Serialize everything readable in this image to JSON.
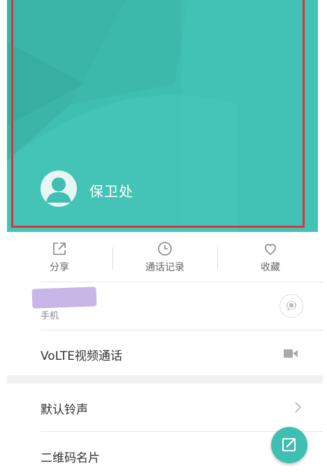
{
  "contact": {
    "name": "保卫处"
  },
  "actions": {
    "share": "分享",
    "call_log": "通话记录",
    "favorite": "收藏"
  },
  "phone": {
    "type_label": "手机"
  },
  "volte": {
    "label": "VoLTE视频通话"
  },
  "ringtone": {
    "label": "默认铃声"
  },
  "qrcard": {
    "label": "二维码名片"
  },
  "colors": {
    "header_teal": "#3fbfb1",
    "highlight_red": "#d9343b",
    "redaction_purple": "#c9b6e8"
  },
  "icons": {
    "share": "share-icon",
    "call_log": "clock-icon",
    "favorite": "heart-icon",
    "message": "message-icon",
    "video": "video-camera-icon",
    "chevron": "chevron-right-icon",
    "edit": "edit-icon"
  }
}
